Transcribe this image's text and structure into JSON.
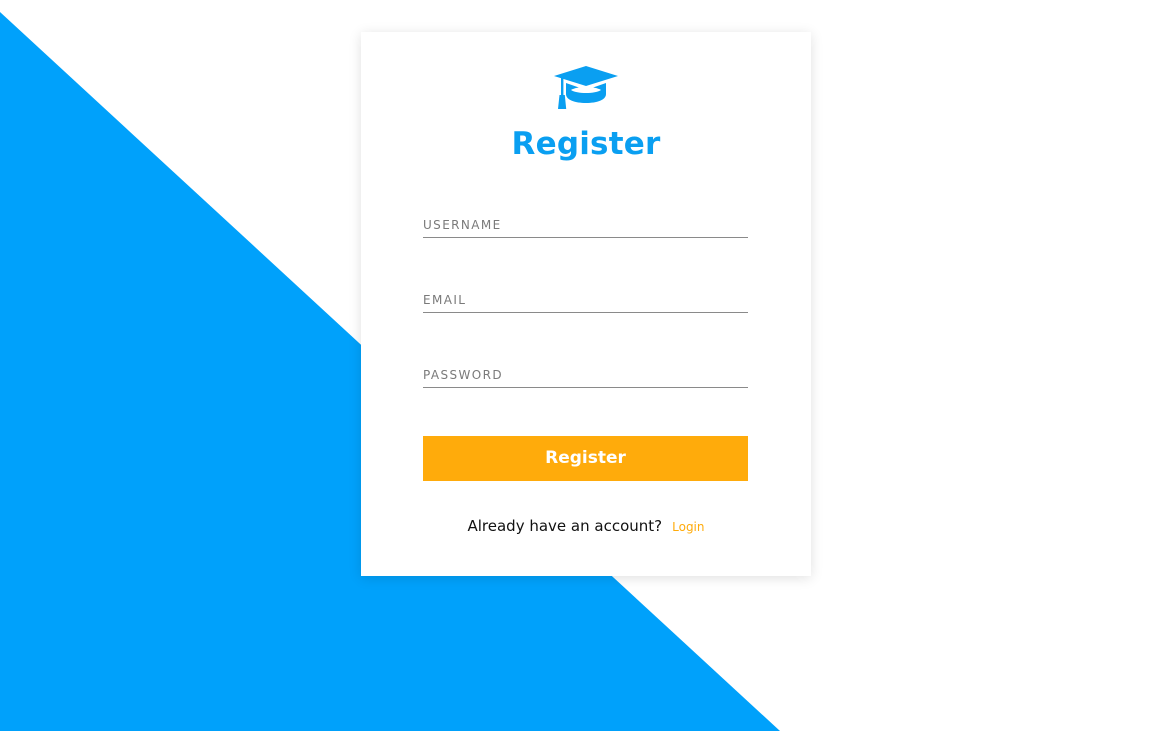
{
  "brand": {
    "primary_color": "#0a9ff1",
    "accent_color": "#ffab0b",
    "logo_icon": "graduation-cap-icon"
  },
  "form": {
    "title": "Register",
    "fields": {
      "username": {
        "placeholder": "USERNAME",
        "value": ""
      },
      "email": {
        "placeholder": "EMAIL",
        "value": ""
      },
      "password": {
        "placeholder": "PASSWORD",
        "value": ""
      }
    },
    "submit_label": "Register"
  },
  "footer": {
    "prompt": "Already have an account?",
    "login_label": "Login"
  }
}
